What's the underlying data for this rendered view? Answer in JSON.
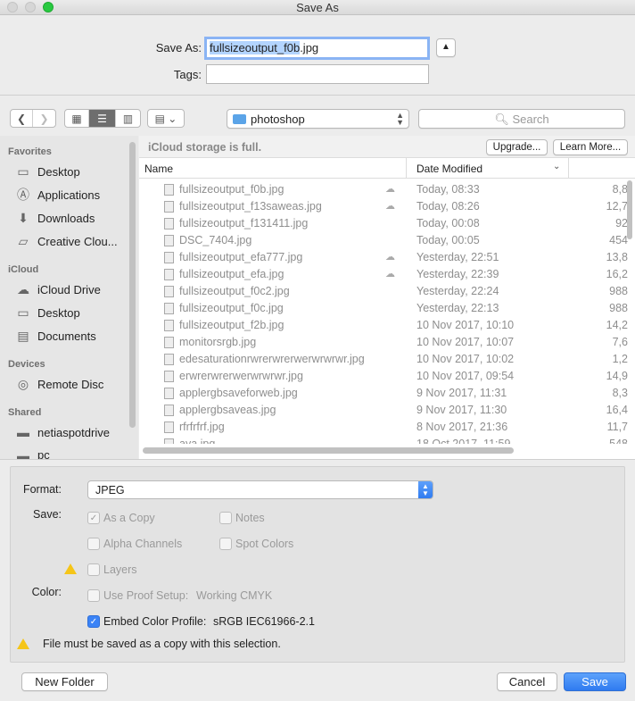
{
  "window": {
    "title": "Save As"
  },
  "name_area": {
    "save_as_label": "Save As:",
    "filename_selected": "fullsizeoutput_f0b",
    "filename_ext": ".jpg",
    "tags_label": "Tags:",
    "tags_value": ""
  },
  "toolbar": {
    "location": "photoshop",
    "search_placeholder": "Search"
  },
  "sidebar": {
    "sections": [
      {
        "title": "Favorites",
        "items": [
          {
            "label": "Desktop",
            "icon": "desktop-icon"
          },
          {
            "label": "Applications",
            "icon": "applications-icon"
          },
          {
            "label": "Downloads",
            "icon": "downloads-icon"
          },
          {
            "label": "Creative Clou...",
            "icon": "folder-icon"
          }
        ]
      },
      {
        "title": "iCloud",
        "items": [
          {
            "label": "iCloud Drive",
            "icon": "cloud-icon"
          },
          {
            "label": "Desktop",
            "icon": "desktop-icon"
          },
          {
            "label": "Documents",
            "icon": "documents-icon"
          }
        ]
      },
      {
        "title": "Devices",
        "items": [
          {
            "label": "Remote Disc",
            "icon": "disc-icon"
          }
        ]
      },
      {
        "title": "Shared",
        "items": [
          {
            "label": "netiaspotdrive",
            "icon": "computer-icon"
          },
          {
            "label": "pc",
            "icon": "computer-icon"
          }
        ]
      }
    ]
  },
  "banner": {
    "text": "iCloud storage is full.",
    "upgrade_label": "Upgrade...",
    "learn_more_label": "Learn More..."
  },
  "columns": {
    "name": "Name",
    "date_modified": "Date Modified"
  },
  "files": [
    {
      "name": "fullsizeoutput_f0b.jpg",
      "date": "Today, 08:33",
      "size": "8,8",
      "cloud": true
    },
    {
      "name": "fullsizeoutput_f13saweas.jpg",
      "date": "Today, 08:26",
      "size": "12,7",
      "cloud": true
    },
    {
      "name": "fullsizeoutput_f131411.jpg",
      "date": "Today, 00:08",
      "size": "92",
      "cloud": false
    },
    {
      "name": "DSC_7404.jpg",
      "date": "Today, 00:05",
      "size": "454",
      "cloud": false
    },
    {
      "name": "fullsizeoutput_efa777.jpg",
      "date": "Yesterday, 22:51",
      "size": "13,8",
      "cloud": true
    },
    {
      "name": "fullsizeoutput_efa.jpg",
      "date": "Yesterday, 22:39",
      "size": "16,2",
      "cloud": true
    },
    {
      "name": "fullsizeoutput_f0c2.jpg",
      "date": "Yesterday, 22:24",
      "size": "988",
      "cloud": false
    },
    {
      "name": "fullsizeoutput_f0c.jpg",
      "date": "Yesterday, 22:13",
      "size": "988",
      "cloud": false
    },
    {
      "name": "fullsizeoutput_f2b.jpg",
      "date": "10 Nov 2017, 10:10",
      "size": "14,2",
      "cloud": false
    },
    {
      "name": "monitorsrgb.jpg",
      "date": "10 Nov 2017, 10:07",
      "size": "7,6",
      "cloud": false
    },
    {
      "name": "edesaturationrwrerwrerwerwrwrwr.jpg",
      "date": "10 Nov 2017, 10:02",
      "size": "1,2",
      "cloud": false
    },
    {
      "name": "erwrerwrerwerwrwrwr.jpg",
      "date": "10 Nov 2017, 09:54",
      "size": "14,9",
      "cloud": false
    },
    {
      "name": "applergbsaveforweb.jpg",
      "date": "9 Nov 2017, 11:31",
      "size": "8,3",
      "cloud": false
    },
    {
      "name": "applergbsaveas.jpg",
      "date": "9 Nov 2017, 11:30",
      "size": "16,4",
      "cloud": false
    },
    {
      "name": "rfrfrfrf.jpg",
      "date": "8 Nov 2017, 21:36",
      "size": "11,7",
      "cloud": false
    },
    {
      "name": "aya.jpg",
      "date": "18 Oct 2017, 11:59",
      "size": "548",
      "cloud": false
    }
  ],
  "options": {
    "format_label": "Format:",
    "format_value": "JPEG",
    "save_label": "Save:",
    "as_copy": "As a Copy",
    "notes": "Notes",
    "alpha_channels": "Alpha Channels",
    "spot_colors": "Spot Colors",
    "layers": "Layers",
    "color_label": "Color:",
    "use_proof_setup": "Use Proof Setup:",
    "proof_profile": "Working CMYK",
    "embed_color_profile": "Embed Color Profile:",
    "embed_profile_value": "sRGB IEC61966-2.1",
    "warning": "File must be saved as a copy with this selection."
  },
  "footer": {
    "new_folder": "New Folder",
    "cancel": "Cancel",
    "save": "Save"
  },
  "colors": {
    "accent": "#2f7bf0",
    "selection": "#b3d4fe"
  }
}
